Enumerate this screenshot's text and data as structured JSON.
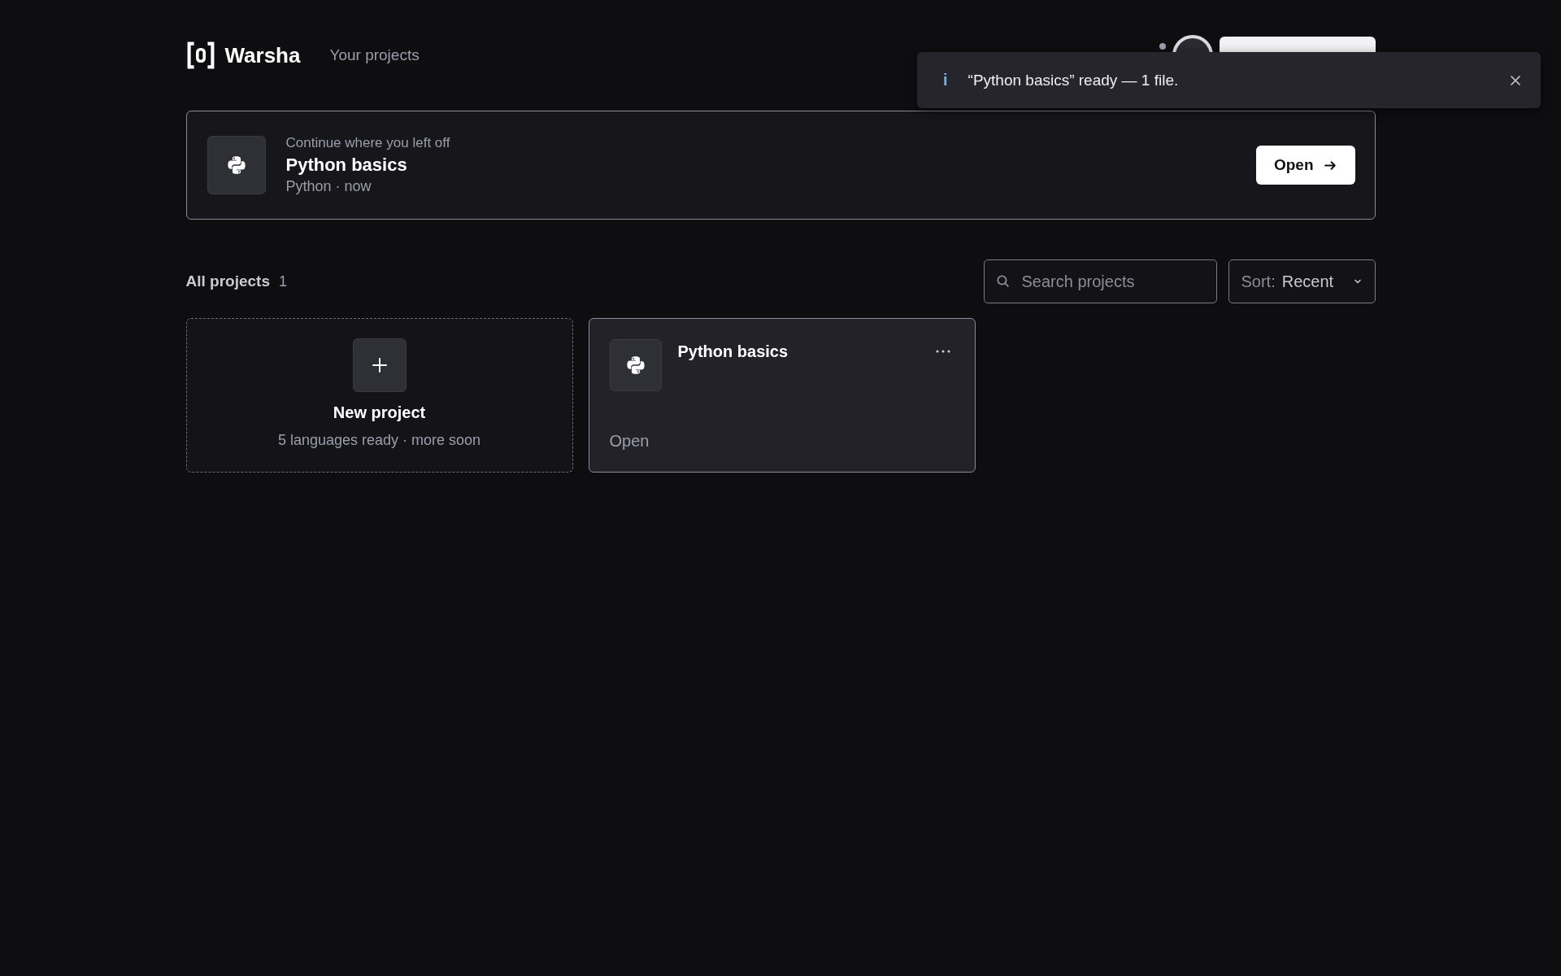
{
  "header": {
    "brand": "Warsha",
    "nav_link": "Your projects"
  },
  "toast": {
    "icon": "i",
    "message": "“Python basics” ready — 1 file."
  },
  "continue_card": {
    "caption": "Continue where you left off",
    "title": "Python basics",
    "meta": "Python · now",
    "button": "Open"
  },
  "projects_section": {
    "title": "All projects",
    "count": "1",
    "search": {
      "placeholder": "Search projects"
    },
    "sort": {
      "label": "Sort:",
      "value": "Recent"
    }
  },
  "cards": [
    {
      "kind": "new",
      "title": "New project",
      "subtitle": "5 languages ready · more soon"
    },
    {
      "kind": "project",
      "title": "Python basics",
      "action": "Open"
    }
  ]
}
